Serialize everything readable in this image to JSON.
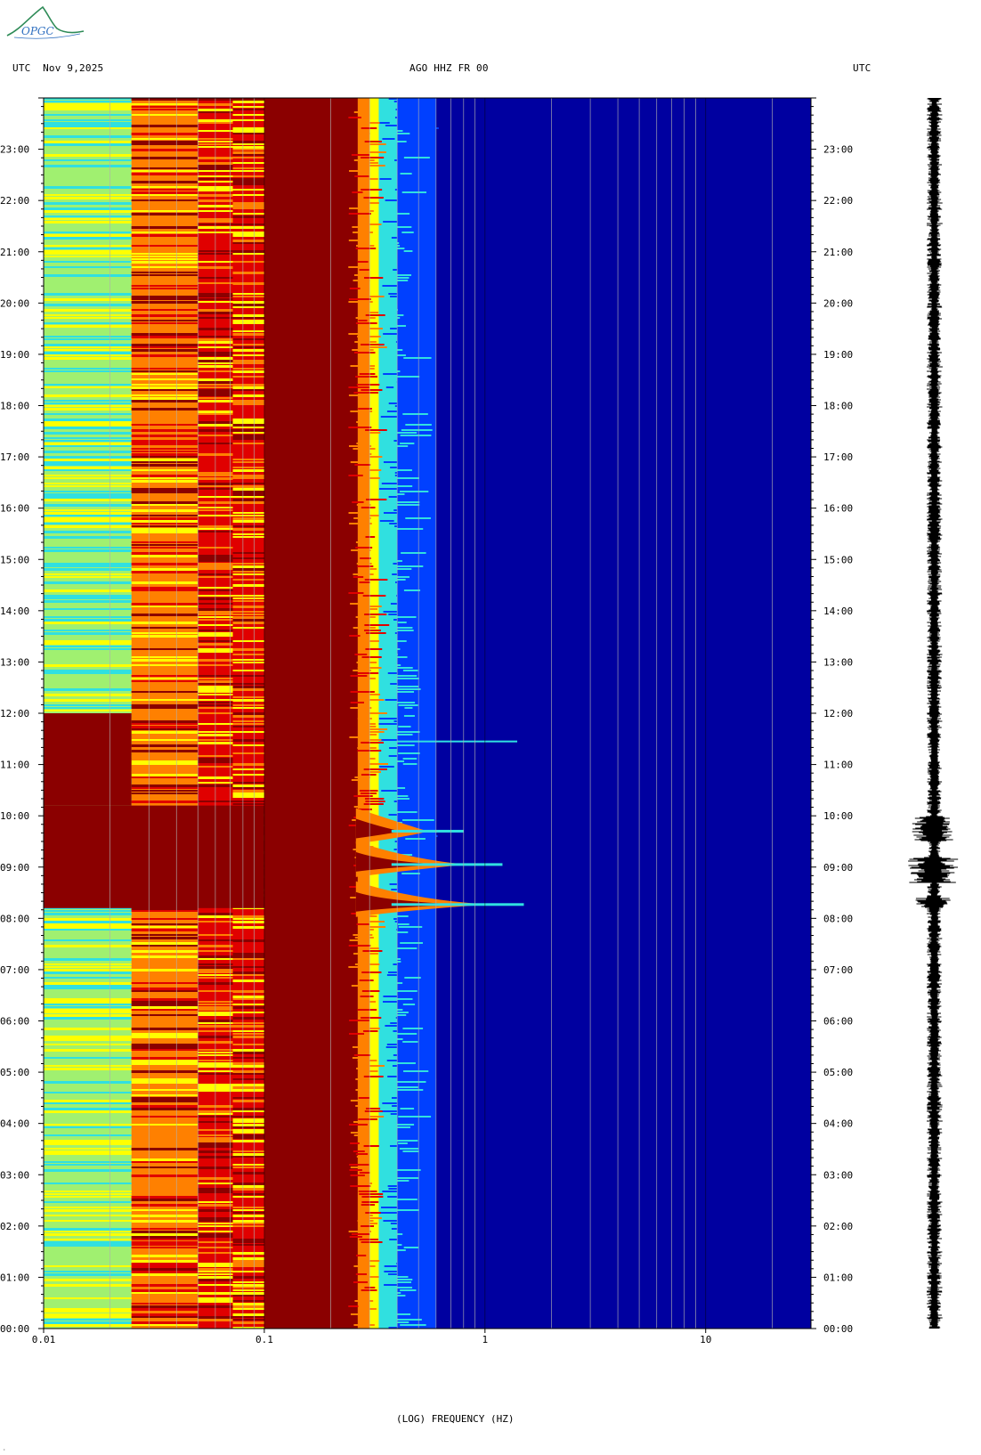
{
  "header": {
    "logo_text": "OPGC",
    "left": "UTC  Nov 9,2025",
    "center": "AGO HHZ FR 00",
    "right": "UTC"
  },
  "colors": {
    "dark_red": "#8b0000",
    "red": "#e00000",
    "orange": "#ff8000",
    "yellow": "#ffff00",
    "light_green": "#a0f070",
    "cyan": "#30e0e0",
    "blue": "#0040ff",
    "deep_blue": "#0000a0",
    "grid": "#b0b0b0",
    "trace": "#000000",
    "logo_green": "#2e8b57",
    "logo_blue": "#3070c0"
  },
  "corner_mark": "·",
  "chart_data": {
    "type": "heatmap",
    "xlabel": "(LOG) FREQUENCY (HZ)",
    "x_scale": "log",
    "xlim": [
      0.01,
      30
    ],
    "x_ticks": [
      {
        "value": 0.01,
        "label": "0.01"
      },
      {
        "value": 0.1,
        "label": "0.1"
      },
      {
        "value": 1,
        "label": "1"
      },
      {
        "value": 10,
        "label": "10"
      }
    ],
    "ylim_hours": [
      0,
      24
    ],
    "y_ticks": [
      "00:00",
      "01:00",
      "02:00",
      "03:00",
      "04:00",
      "05:00",
      "06:00",
      "07:00",
      "08:00",
      "09:00",
      "10:00",
      "11:00",
      "12:00",
      "13:00",
      "14:00",
      "15:00",
      "16:00",
      "17:00",
      "18:00",
      "19:00",
      "20:00",
      "21:00",
      "22:00",
      "23:00"
    ],
    "frequency_bands": [
      {
        "f0": 0.01,
        "f1": 0.025,
        "color": "light_green"
      },
      {
        "f0": 0.025,
        "f1": 0.05,
        "color": "orange"
      },
      {
        "f0": 0.05,
        "f1": 0.072,
        "color": "red"
      },
      {
        "f0": 0.072,
        "f1": 0.1,
        "color": "red"
      },
      {
        "f0": 0.1,
        "f1": 0.265,
        "color": "dark_red"
      },
      {
        "f0": 0.265,
        "f1": 0.3,
        "color": "orange"
      },
      {
        "f0": 0.3,
        "f1": 0.33,
        "color": "yellow"
      },
      {
        "f0": 0.33,
        "f1": 0.4,
        "color": "cyan"
      },
      {
        "f0": 0.4,
        "f1": 0.6,
        "color": "blue"
      },
      {
        "f0": 0.6,
        "f1": 30,
        "color": "deep_blue"
      }
    ],
    "events": [
      {
        "name": "saturation",
        "start_hour": 8.2,
        "end_hour": 10.2,
        "f_max": 0.1
      },
      {
        "name": "saturation",
        "start_hour": 10.2,
        "end_hour": 12.0,
        "f_max": 0.025
      },
      {
        "name": "peak",
        "hour": 8.27,
        "f_peak": 1.5
      },
      {
        "name": "peak",
        "hour": 9.05,
        "f_peak": 1.2
      },
      {
        "name": "peak",
        "hour": 9.7,
        "f_peak": 0.8
      },
      {
        "name": "line",
        "hour": 11.45,
        "f_max": 1.4
      }
    ],
    "seismogram": {
      "base_amplitude": 0.3,
      "bursts": [
        {
          "start_hour": 8.2,
          "end_hour": 8.4,
          "amplitude": 0.8
        },
        {
          "start_hour": 8.7,
          "end_hour": 9.2,
          "amplitude": 1.0
        },
        {
          "start_hour": 9.5,
          "end_hour": 10.0,
          "amplitude": 0.85
        }
      ]
    }
  }
}
